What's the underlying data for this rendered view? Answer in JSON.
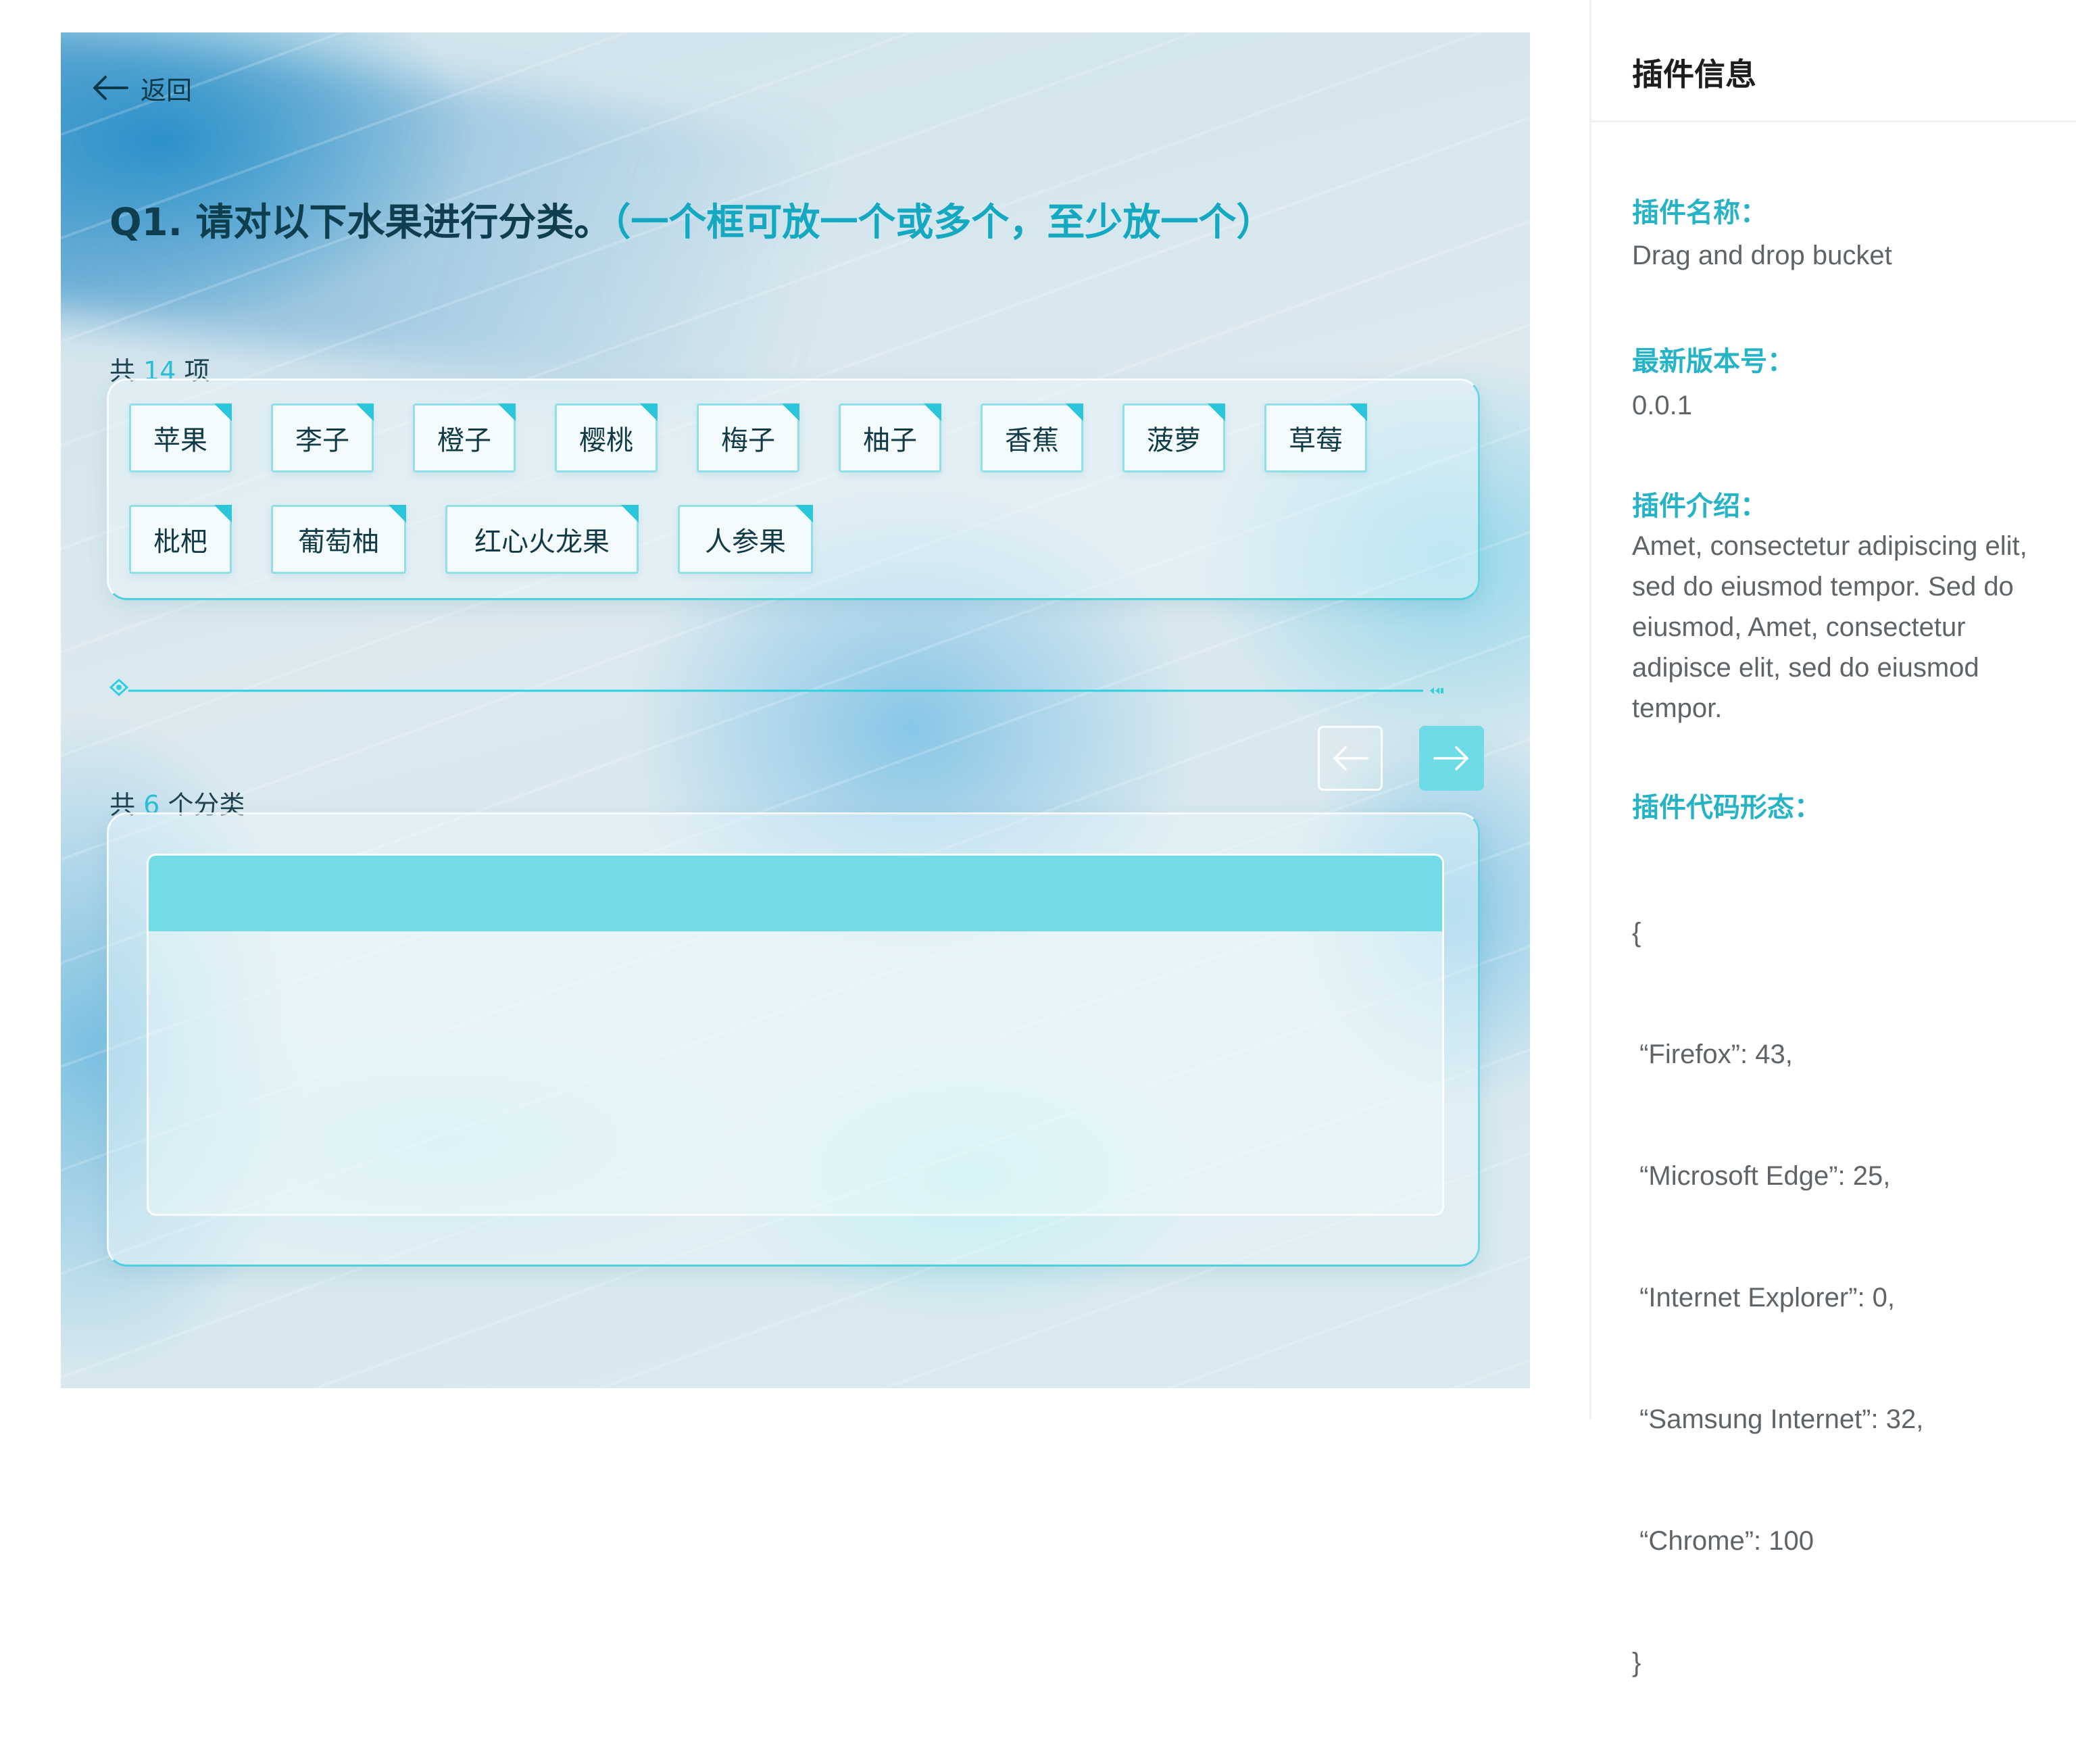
{
  "main": {
    "back_label": "返回",
    "question": {
      "prefix": "Q1. 请对以下水果进行分类。",
      "hint": "（一个框可放一个或多个，至少放一个）"
    },
    "items_count": {
      "before": "共",
      "number": "14",
      "after": "项"
    },
    "items": [
      "苹果",
      "李子",
      "橙子",
      "樱桃",
      "梅子",
      "柚子",
      "香蕉",
      "菠萝",
      "草莓",
      "枇杷",
      "葡萄柚",
      "红心火龙果",
      "人参果"
    ],
    "categories_count": {
      "before": "共",
      "number": "6",
      "after": "个分类"
    },
    "bucket": {
      "title": ""
    },
    "colors": {
      "accent": "#2bbfd5",
      "bucket_header": "#73dbe6",
      "title_text": "#0f3f4f"
    }
  },
  "panel": {
    "title": "插件信息",
    "name_label": "插件名称：",
    "name_value": "Drag and drop bucket",
    "version_label": "最新版本号：",
    "version_value": "0.0.1",
    "intro_label": "插件介绍：",
    "intro_value": "Amet, consectetur adipiscing elit, sed do eiusmod tempor. Sed do eiusmod, Amet, consectetur adipisce elit, sed do eiusmod tempor.",
    "code_label": "插件代码形态：",
    "code_lines": [
      "{",
      " “Firefox”: 43,",
      " “Microsoft Edge”: 25,",
      " “Internet Explorer”: 0,",
      " “Samsung Internet”: 32,",
      " “Chrome”: 100",
      "}"
    ]
  },
  "icons": {
    "back": "arrow-left-icon",
    "prev": "arrow-left-icon",
    "next": "arrow-right-icon",
    "divider": "diamond-icon"
  }
}
